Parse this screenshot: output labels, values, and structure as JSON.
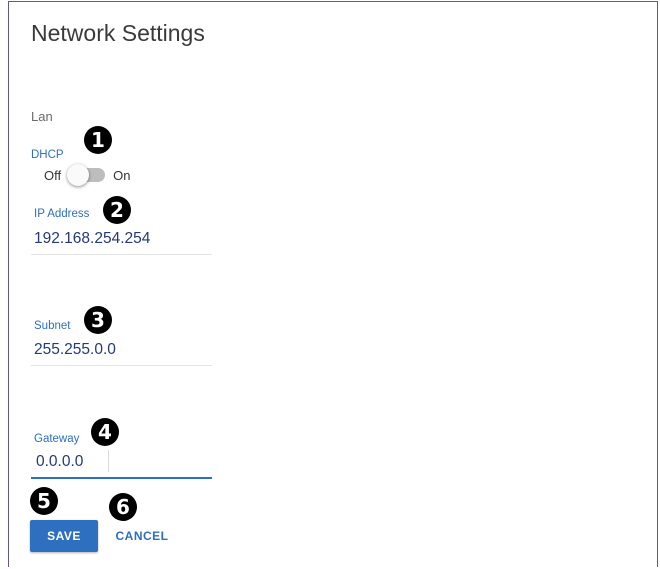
{
  "page": {
    "title": "Network Settings"
  },
  "lan": {
    "section_label": "Lan",
    "dhcp": {
      "label": "DHCP",
      "off_label": "Off",
      "on_label": "On",
      "state": "off"
    },
    "ip_address": {
      "label": "IP Address",
      "value": "192.168.254.254"
    },
    "subnet": {
      "label": "Subnet",
      "value": "255.255.0.0"
    },
    "gateway": {
      "label": "Gateway",
      "value": "0.0.0.0"
    }
  },
  "actions": {
    "save_label": "SAVE",
    "cancel_label": "CANCEL"
  },
  "callouts": [
    "1",
    "2",
    "3",
    "4",
    "5",
    "6"
  ],
  "colors": {
    "accent": "#2f6fbf",
    "value_text": "#233a7a",
    "callout": "#000000"
  }
}
